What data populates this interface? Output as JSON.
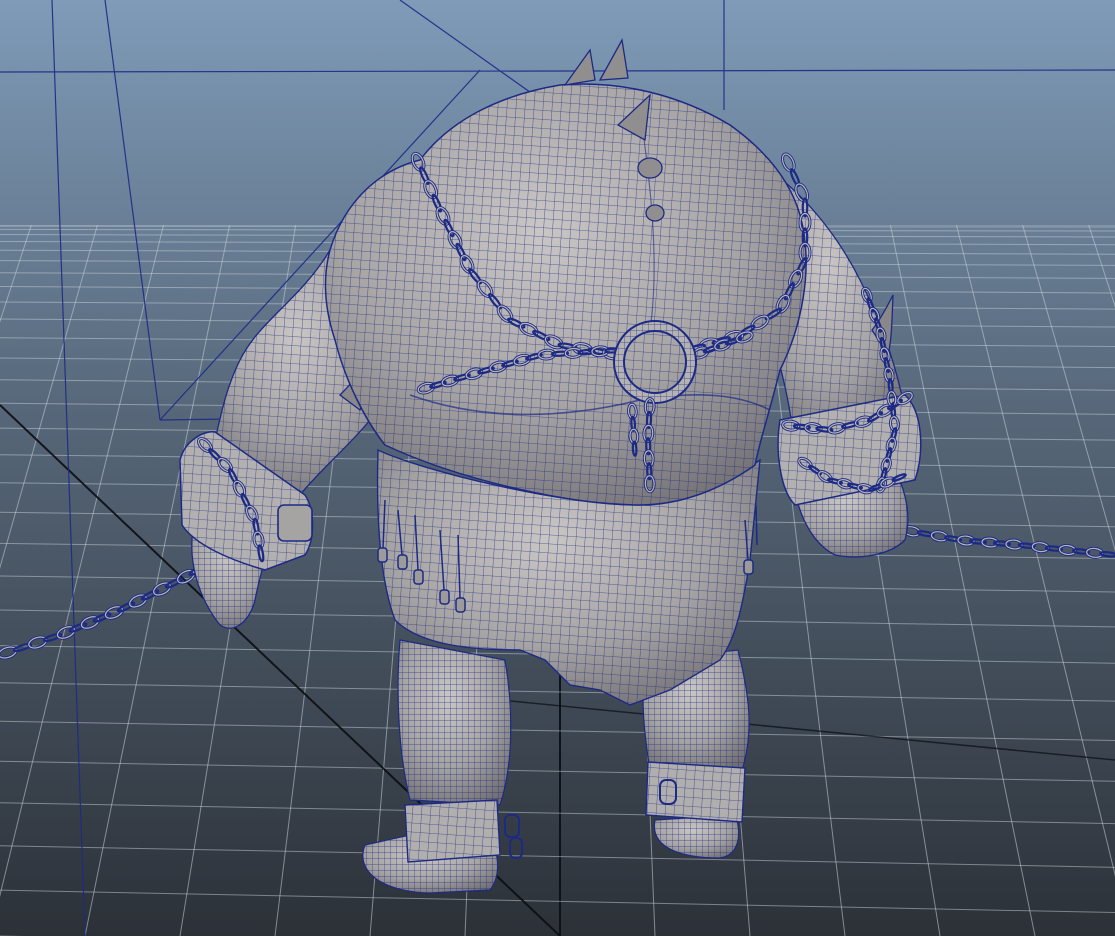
{
  "viewport": {
    "background_top": "#7f9bb8",
    "background_bottom": "#2c3138",
    "grid_color": "#c9d1d8",
    "axis_color": "#0b0e12",
    "wire_color": "#1c2a86",
    "wire_color_light": "#3a48b0",
    "mesh_fill": "#a7a4a4",
    "mesh_shade": "#6f6d70",
    "mesh_highlight": "#c9c6c4"
  },
  "model": {
    "subject": "ogre-character-back-view",
    "parts": [
      "head-spikes",
      "back",
      "harness-chains",
      "back-ring",
      "left-arm",
      "right-arm",
      "wrist-cuffs",
      "loincloth",
      "legs",
      "ankle-cuffs",
      "feet",
      "floor-chains"
    ]
  }
}
